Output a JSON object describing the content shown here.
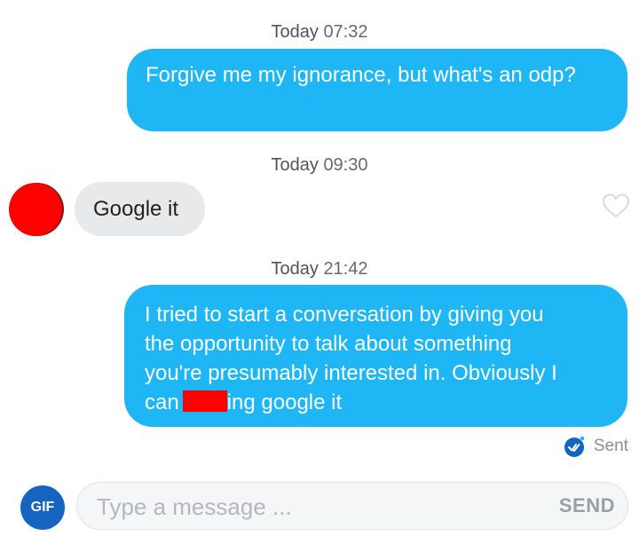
{
  "conversation": {
    "messages": [
      {
        "timestamp_day": "Today",
        "timestamp_time": "07:32",
        "direction": "outgoing",
        "text": "Forgive me my ignorance, but what's an odp?"
      },
      {
        "timestamp_day": "Today",
        "timestamp_time": "09:30",
        "direction": "incoming",
        "text": "Google it"
      },
      {
        "timestamp_day": "Today",
        "timestamp_time": "21:42",
        "direction": "outgoing",
        "text_line_1": "I tried to start a conversation by giving you",
        "text_line_2": "the opportunity to talk about something",
        "text_line_3": "you're presumably interested in. Obviously I",
        "text_line_4_before": "can",
        "text_line_4_after": "ing google it",
        "redaction_color": "#ff0000"
      }
    ],
    "status": "Sent"
  },
  "avatar": {
    "color": "#ff0000"
  },
  "composer": {
    "gif_label": "GIF",
    "placeholder": "Type a message ...",
    "send_label": "SEND"
  },
  "icons": {
    "like": "heart-outline-icon",
    "status": "sent-check-icon"
  },
  "colors": {
    "outgoing_bubble": "#1fb6f5",
    "incoming_bubble": "#e8e9ea",
    "gif_button": "#1565c0"
  }
}
